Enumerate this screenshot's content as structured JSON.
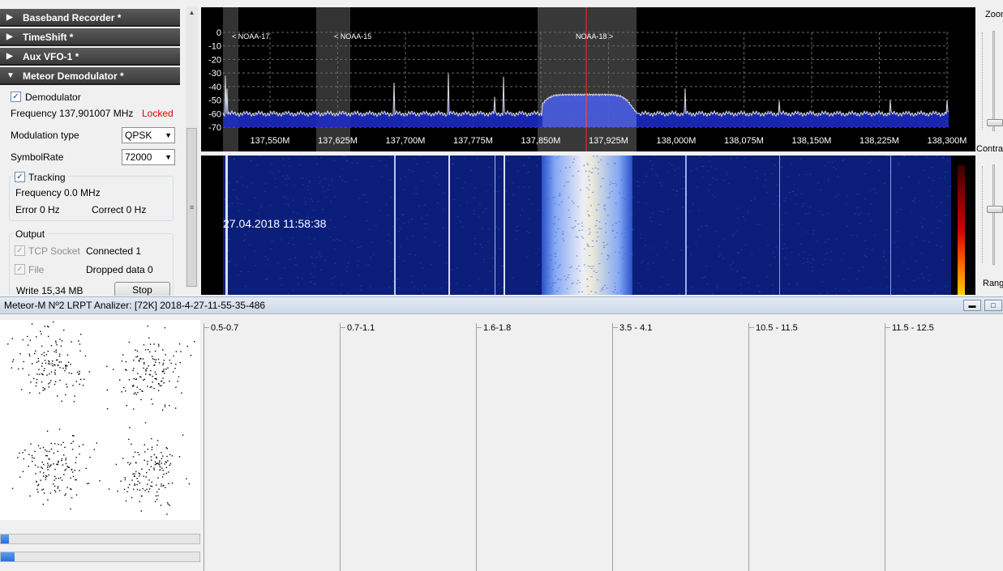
{
  "plugins": [
    {
      "label": "Baseband Recorder *",
      "expanded": false
    },
    {
      "label": "TimeShift *",
      "expanded": false
    },
    {
      "label": "Aux VFO-1 *",
      "expanded": false
    },
    {
      "label": "Meteor Demodulator *",
      "expanded": true
    }
  ],
  "demodulator": {
    "enabled_label": "Demodulator",
    "frequency_label": "Frequency 137,901007 MHz",
    "status": "Locked",
    "status_color": "#e00000",
    "modulation_label": "Modulation type",
    "modulation_value": "QPSK",
    "symbolrate_label": "SymbolRate",
    "symbolrate_value": "72000"
  },
  "tracking": {
    "label": "Tracking",
    "frequency": "Frequency 0.0 MHz",
    "error": "Error 0 Hz",
    "correct": "Correct 0 Hz"
  },
  "output": {
    "group_label": "Output",
    "tcp_label": "TCP Socket",
    "tcp_status": "Connected 1",
    "file_label": "File",
    "dropped": "Dropped data 0",
    "write": "Write 15,34 MB",
    "stop_label": "Stop"
  },
  "spectrum": {
    "db_ticks": [
      "0",
      "-10",
      "-20",
      "-30",
      "-40",
      "-50",
      "-60",
      "-70"
    ],
    "freq_ticks": [
      "137,550M",
      "137,625M",
      "137,700M",
      "137,775M",
      "137,850M",
      "137,925M",
      "138,000M",
      "138,075M",
      "138,150M",
      "138,225M",
      "138,300M"
    ],
    "markers": [
      {
        "label": "< NOAA-17"
      },
      {
        "label": "< NOAA-15"
      },
      {
        "label": "NOAA-18 >"
      }
    ],
    "trace_color": "#dcdcdc",
    "fill_color": "#1c2bd0"
  },
  "waterfall": {
    "timestamp": "27.04.2018 11:58:38"
  },
  "right_panel": {
    "zoom_label": "Zoom",
    "contrast_label": "Contra",
    "range_label": "Rang"
  },
  "analyzer": {
    "title": "Meteor-M Nº2 LRPT Analizer: [72K] 2018-4-27-11-55-35-486",
    "progress1": 0.04,
    "progress2": 0.07,
    "histograms": [
      "0.5-0.7",
      "0.7-1.1",
      "1.6-1.8",
      "3.5 - 4.1",
      "10.5 - 11.5",
      "11.5 - 12.5"
    ]
  }
}
